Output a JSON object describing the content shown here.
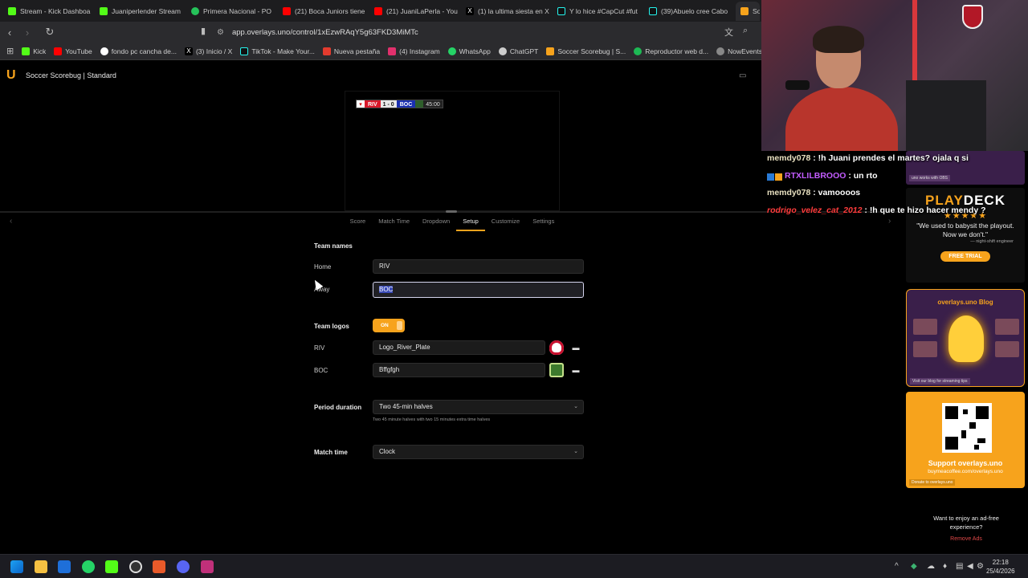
{
  "browser": {
    "tabs": [
      {
        "label": "Stream - Kick Dashboa",
        "color": "#53fc18"
      },
      {
        "label": "Juaniperlender Stream",
        "color": "#53fc18"
      },
      {
        "label": "Primera Nacional - PO",
        "color": "#25c25a"
      },
      {
        "label": "(21) Boca Juniors tiene",
        "color": "#ff0000"
      },
      {
        "label": "(21) JuaniLaPerla - You",
        "color": "#ff0000"
      },
      {
        "label": "(1) la ultima siesta en X",
        "color": "#ffffff"
      },
      {
        "label": "Y lo hice #CapCut #fut",
        "color": "#111111"
      },
      {
        "label": "(39)Abuelo cree Cabo",
        "color": "#111111"
      },
      {
        "label": "Soc",
        "color": "#f7a31c"
      }
    ],
    "url": "app.overlays.uno/control/1xEzwRAqY5g63FKD3MiMTc",
    "bookmarks": [
      {
        "label": "Kick",
        "color": "#53fc18"
      },
      {
        "label": "YouTube",
        "color": "#ff0000"
      },
      {
        "label": "fondo pc cancha de...",
        "color": "#4285f4"
      },
      {
        "label": "(3) Inicio / X",
        "color": "#ffffff"
      },
      {
        "label": "TikTok - Make Your...",
        "color": "#25f4ee"
      },
      {
        "label": "Nueva pestaña",
        "color": "#e33b2e"
      },
      {
        "label": "(4) Instagram",
        "color": "#e1306c"
      },
      {
        "label": "WhatsApp",
        "color": "#25d366"
      },
      {
        "label": "ChatGPT",
        "color": "#cccccc"
      },
      {
        "label": "Soccer Scorebug | S...",
        "color": "#f7a31c"
      },
      {
        "label": "Reproductor web d...",
        "color": "#1db954"
      },
      {
        "label": "NowEvents - C",
        "color": "#888888"
      }
    ]
  },
  "app": {
    "logo": "U",
    "title": "Soccer Scorebug | Standard"
  },
  "scorebug": {
    "home": "RIV",
    "score": "1 - 0",
    "away": "BOC",
    "time": "45:00"
  },
  "tabs": [
    "Score",
    "Match Time",
    "Dropdown",
    "Setup",
    "Customize",
    "Settings"
  ],
  "form": {
    "team_names_heading": "Team names",
    "home_label": "Home",
    "home_value": "RIV",
    "away_label": "Away",
    "away_value": "BOC",
    "team_logos_heading": "Team logos",
    "toggle_label": "ON",
    "riv_label": "RIV",
    "riv_logo_value": "Logo_River_Plate",
    "boc_label": "BOC",
    "boc_logo_value": "Bffgfgh",
    "period_label": "Period duration",
    "period_value": "Two 45-min halves",
    "period_hint": "Two 45 minute halves with two 15 minutes extra time halves",
    "match_time_label": "Match time",
    "match_time_value": "Clock"
  },
  "chat": [
    {
      "user": "memdy078",
      "text": " : !h Juani prendes el martes? ojala q si"
    },
    {
      "user": "RTXLILBROOO",
      "text": " : un rto"
    },
    {
      "user": "memdy078",
      "text": " : vamoooos"
    },
    {
      "user": "rodrigo_velez_cat_2012",
      "text": " : !h que te hizo hacer mendy ?"
    }
  ],
  "ads": {
    "ad1_caption": "uno works with OBS",
    "brand_a": "PLAY",
    "brand_b": "DECK",
    "stars": "★★★★★",
    "quote": "\"We used to babysit the playout. Now we don't.\"",
    "quote_author": "— night-shift engineer",
    "trial": "FREE TRIAL",
    "blog_title": "overlays.uno Blog",
    "blog_caption": "Visit our blog for streaming tips",
    "support_title": "Support overlays.uno",
    "support_url": "buymeacoffee.com/overlays.uno",
    "support_caption": "Donate to overlays.uno",
    "adfree": "Want to enjoy an ad-free experience?",
    "remove": "Remove Ads"
  },
  "clock": {
    "time": "22:18",
    "date": "25/4/2026"
  }
}
